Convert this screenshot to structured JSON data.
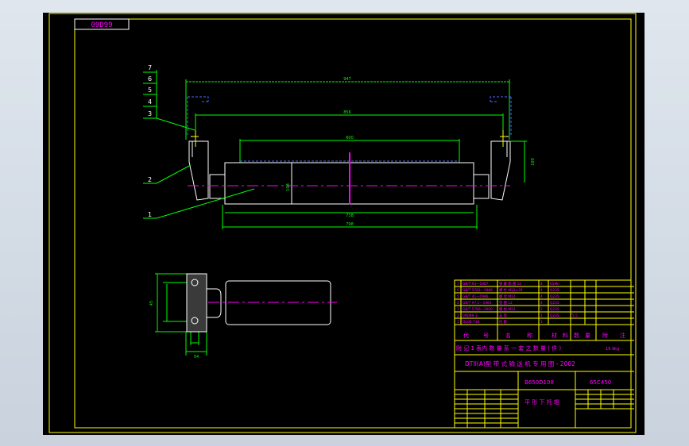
{
  "drawing_number": "09D99",
  "colors": {
    "background": "#000000",
    "frame": "#ffff00",
    "outline": "#ffffff",
    "dimension": "#00ff00",
    "centerline": "#ff00ff",
    "hidden": "#4a6cff",
    "text": "#ff00ff"
  },
  "callouts": [
    "7",
    "6",
    "5",
    "4",
    "3",
    "2",
    "1"
  ],
  "dimensions": {
    "overall_top": "947",
    "inner_top": "856",
    "roller_face": "600",
    "roller_length": "738",
    "shaft_length": "798",
    "height": "100",
    "diameter": "108",
    "side_height": "45",
    "side_width": "54"
  },
  "parts_table": {
    "rows": [
      [
        "7",
        "GB/T 93—1987",
        "弹 簧 垫 圈 12",
        "4",
        "65Mn",
        "",
        "",
        ""
      ],
      [
        "6",
        "GB/T 5783—1986",
        "螺 栓 M12×35",
        "4",
        "Q235",
        "",
        "",
        ""
      ],
      [
        "5",
        "GB/T 41—1986",
        "螺 母 M12",
        "4",
        "Q235",
        "",
        "",
        ""
      ],
      [
        "4",
        "GB/T 97.1—1985",
        "垫 圈 12",
        "4",
        "Q235",
        "",
        "",
        ""
      ],
      [
        "3",
        "GB/T 5780—2000",
        "螺 栓 M12",
        "2",
        "Q235",
        "",
        "",
        ""
      ],
      [
        "2",
        "09D99-1",
        "支 架",
        "1",
        "Q235",
        "5.5",
        "",
        ""
      ],
      [
        "1",
        "D108-738",
        "托 辊",
        "1",
        "",
        "",
        "",
        ""
      ]
    ],
    "header": [
      "代",
      "号",
      "名",
      "称",
      "材",
      "料",
      "数",
      "量",
      "附",
      "注"
    ],
    "note": "附 记 1 表内 数 量 系 一 套 之 数 量 ( 件 )",
    "weight": "19.9kg",
    "title_row": "DTII(A)型 带 式 输 送 机 专 用 图 - 2002",
    "model": "B650D108",
    "code": "65C450",
    "name": "平 形 下 托 辊"
  }
}
